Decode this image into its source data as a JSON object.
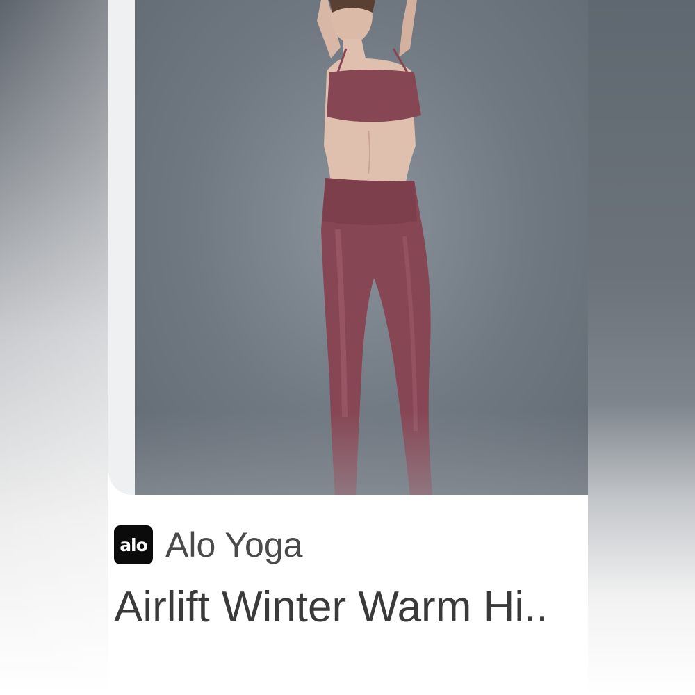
{
  "listing": {
    "brand": {
      "logo_text": "alo",
      "name": "Alo Yoga"
    },
    "title": "Airlift Winter Warm Hi..",
    "photo": {
      "icon": "product-photo",
      "outfit_color": "#874654",
      "background_color": "#6f7780"
    }
  }
}
